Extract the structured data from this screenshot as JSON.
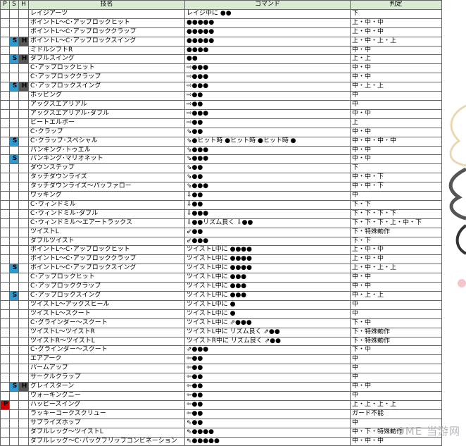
{
  "headers": {
    "p": "P",
    "s": "S",
    "h": "H",
    "name": "技名",
    "command": "コマンド",
    "judge": "判定"
  },
  "rows": [
    {
      "p": "",
      "s": "",
      "h": "",
      "name": "レイジアーツ",
      "cmd": "レイジ中に ●●",
      "judge": "下"
    },
    {
      "p": "",
      "s": "",
      "h": "",
      "name": "ポイントL～C･アップロックヒット",
      "cmd": "●●●●●",
      "judge": "上・中・中"
    },
    {
      "p": "",
      "s": "",
      "h": "",
      "name": "ポイントL～C･アップロッククラップ",
      "cmd": "●●●●●",
      "judge": "上・中・中"
    },
    {
      "p": "",
      "s": "S",
      "h": "H",
      "name": "ポイントL～C･アップロックスイング",
      "cmd": "●●●●●",
      "judge": "上・中・上・上"
    },
    {
      "p": "",
      "s": "",
      "h": "",
      "name": "ミドルシフトR",
      "cmd": "●●●●",
      "judge": "中・中"
    },
    {
      "p": "",
      "s": "S",
      "h": "H",
      "name": "ダブルスイング",
      "cmd": "●●",
      "judge": "上・上"
    },
    {
      "p": "",
      "s": "",
      "h": "",
      "name": "C･アップロックヒット",
      "cmd": "⇨●●●",
      "judge": "中・中"
    },
    {
      "p": "",
      "s": "",
      "h": "",
      "name": "C･アップロッククラップ",
      "cmd": "⇨●●●",
      "judge": "中・中"
    },
    {
      "p": "",
      "s": "S",
      "h": "H",
      "name": "C･アップロックスイング",
      "cmd": "⇨●●●",
      "judge": "中・上・上"
    },
    {
      "p": "",
      "s": "",
      "h": "",
      "name": "ホッピング",
      "cmd": "⇨●●",
      "judge": "中"
    },
    {
      "p": "",
      "s": "",
      "h": "",
      "name": "アックスエアリアル",
      "cmd": "⇨●●",
      "judge": "中"
    },
    {
      "p": "",
      "s": "",
      "h": "",
      "name": "アックスエアリアル･ダブル",
      "cmd": "⇨●●●",
      "judge": "中・中"
    },
    {
      "p": "",
      "s": "",
      "h": "",
      "name": "ビートエルボー",
      "cmd": "⇨●●",
      "judge": "上"
    },
    {
      "p": "",
      "s": "",
      "h": "",
      "name": "C･クラップ",
      "cmd": "⇘●●",
      "judge": "中・中"
    },
    {
      "p": "",
      "s": "S",
      "h": "",
      "name": "C･クラップ･スペシャル",
      "cmd": "⇘●ヒット時 ●ヒット時 ●ヒット時 ●",
      "judge": "中・中・中・中"
    },
    {
      "p": "",
      "s": "",
      "h": "",
      "name": "パンキング･トゥエル",
      "cmd": "⇘●●●",
      "judge": "中・中"
    },
    {
      "p": "",
      "s": "S",
      "h": "",
      "name": "パンキング･マリオネット",
      "cmd": "⇘●●●",
      "judge": "中・中"
    },
    {
      "p": "",
      "s": "",
      "h": "",
      "name": "ダウンステップ",
      "cmd": "⇘●●",
      "judge": "下"
    },
    {
      "p": "",
      "s": "",
      "h": "",
      "name": "タッチダウンライズ",
      "cmd": "⇘●●",
      "judge": "中・中・下"
    },
    {
      "p": "",
      "s": "",
      "h": "",
      "name": "タッチダウンライズ～パッファロー",
      "cmd": "⇘●●●",
      "judge": "中・中・下"
    },
    {
      "p": "",
      "s": "",
      "h": "",
      "name": "ワッキング",
      "cmd": "⇩●●",
      "judge": "中"
    },
    {
      "p": "",
      "s": "",
      "h": "",
      "name": "C･ウィンドミル",
      "cmd": "⇩●●",
      "judge": "下・下"
    },
    {
      "p": "",
      "s": "",
      "h": "",
      "name": "C･ウィンドミル･ダブル",
      "cmd": "⇩●●●",
      "judge": "下・下・下・下"
    },
    {
      "p": "",
      "s": "",
      "h": "",
      "name": "C･ウィンドミル～エアートラックス",
      "cmd": "⇩●●リズム良く ⇩●●",
      "judge": "下・下・下・上・中・下"
    },
    {
      "p": "",
      "s": "",
      "h": "",
      "name": "ツイストL",
      "cmd": "⇙●●",
      "judge": "下・特殊動作"
    },
    {
      "p": "",
      "s": "",
      "h": "",
      "name": "ダブルツイスト",
      "cmd": "⇙●●●",
      "judge": "下・下"
    },
    {
      "p": "",
      "s": "",
      "h": "",
      "name": "ポイントL～C･アップロックヒット",
      "cmd": "ツイストL中に ●●●●",
      "judge": "上・中・中"
    },
    {
      "p": "",
      "s": "",
      "h": "",
      "name": "ポイントL～C･アップロッククラップ",
      "cmd": "ツイストL中に ●●●●",
      "judge": "上・中・中"
    },
    {
      "p": "",
      "s": "S",
      "h": "",
      "name": "ポイントL～C･アップロックスイング",
      "cmd": "ツイストL中に ●●●●",
      "judge": "上・中・上・上"
    },
    {
      "p": "",
      "s": "",
      "h": "",
      "name": "C･アップロックヒット",
      "cmd": "ツイストL中に ●●●",
      "judge": "中・中"
    },
    {
      "p": "",
      "s": "",
      "h": "",
      "name": "C･アップロッククラップ",
      "cmd": "ツイストL中に ●●●",
      "judge": "中・中"
    },
    {
      "p": "",
      "s": "S",
      "h": "",
      "name": "C･アップロックスイング",
      "cmd": "ツイストL中に ●●●",
      "judge": "中・上・上"
    },
    {
      "p": "",
      "s": "",
      "h": "",
      "name": "ツイストL～アックスヒール",
      "cmd": "ツイストL中に ●",
      "judge": "中"
    },
    {
      "p": "",
      "s": "",
      "h": "",
      "name": "ツイストL～スクート",
      "cmd": "ツイストL中に ●",
      "judge": "中"
    },
    {
      "p": "",
      "s": "",
      "h": "",
      "name": "C･グラインダー～スクート",
      "cmd": "ツイストL中に ⇗●●●",
      "judge": "下・中"
    },
    {
      "p": "",
      "s": "",
      "h": "",
      "name": "ツイストL～ツイストR",
      "cmd": "ツイストL中に リズム良く ⇗●●",
      "judge": "下・特殊動作"
    },
    {
      "p": "",
      "s": "",
      "h": "",
      "name": "ツイストR～ツイストL",
      "cmd": "ツイストR中に リズム良く ⇗●●",
      "judge": "下・特殊動作"
    },
    {
      "p": "",
      "s": "",
      "h": "",
      "name": "C･グラインダー～スクート",
      "cmd": "⇗●●●",
      "judge": "下・中"
    },
    {
      "p": "",
      "s": "",
      "h": "",
      "name": "エアアーク",
      "cmd": "⇦●●",
      "judge": "中"
    },
    {
      "p": "",
      "s": "",
      "h": "",
      "name": "パームアップ",
      "cmd": "⇦●●",
      "judge": "中"
    },
    {
      "p": "",
      "s": "",
      "h": "",
      "name": "サークルクラップ",
      "cmd": "⇦●●",
      "judge": "中"
    },
    {
      "p": "",
      "s": "S",
      "h": "H",
      "name": "グレイスターン",
      "cmd": "⇦●●",
      "judge": "中・中"
    },
    {
      "p": "",
      "s": "",
      "h": "",
      "name": "ウォーキングニー",
      "cmd": "⇦●●",
      "judge": "中"
    },
    {
      "p": "P",
      "s": "",
      "h": "",
      "name": "ハッピースイング",
      "cmd": "⇦●●",
      "judge": "上・上・上・上"
    },
    {
      "p": "",
      "s": "",
      "h": "",
      "name": "ラッキーコークスクリュー",
      "cmd": "⇦●●",
      "judge": "ガード不能"
    },
    {
      "p": "",
      "s": "",
      "h": "",
      "name": "サプライズホップ",
      "cmd": "⇖●●",
      "judge": "中"
    },
    {
      "p": "",
      "s": "",
      "h": "",
      "name": "ダブルレッグ～ツイストL",
      "cmd": "⇖●●●●",
      "judge": "中・下・特殊動作"
    },
    {
      "p": "",
      "s": "",
      "h": "",
      "name": "ダブルレッグ～C･バックフリップコンビネーション",
      "cmd": "⇖●●●●●",
      "judge": "中・中・中"
    }
  ],
  "watermark": "9ME 当游网",
  "colors": {
    "p": "#d00000",
    "s": "#2d9bd2",
    "h": "#555555",
    "header_bg": "#d9ead3",
    "border": "#666666"
  }
}
